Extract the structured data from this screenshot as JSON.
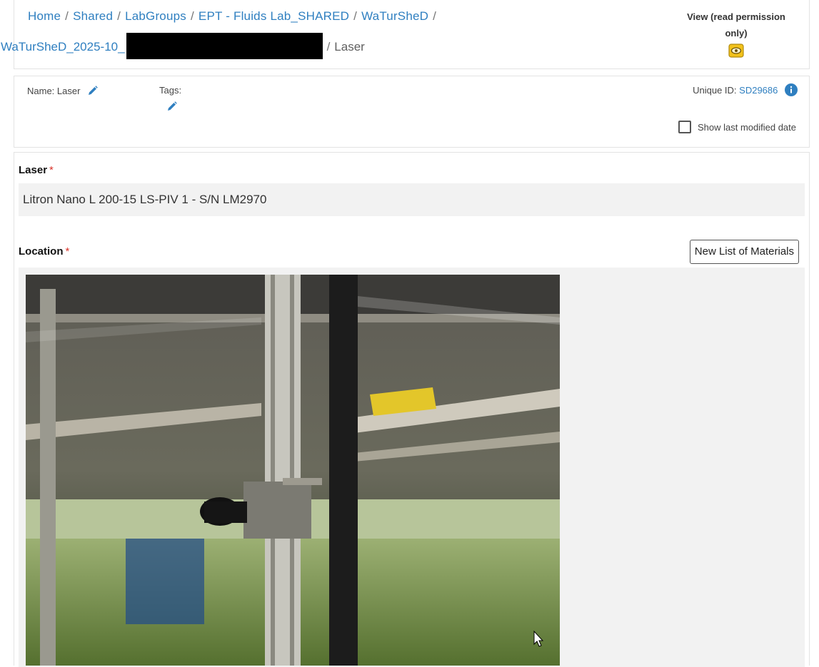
{
  "breadcrumb": {
    "items": [
      "Home",
      "Shared",
      "LabGroups",
      "EPT - Fluids Lab_SHARED",
      "WaTurSheD",
      "WaTurSheD_2025-10_"
    ],
    "current": "Laser",
    "separator": "/"
  },
  "permission": {
    "label": "View (read permission only)",
    "icon": "eye-icon"
  },
  "meta": {
    "name_label": "Name: Laser",
    "tags_label": "Tags:",
    "unique_id_label": "Unique ID:",
    "unique_id_value": "SD29686",
    "show_last_modified_label": "Show last modified date",
    "show_last_modified_checked": false
  },
  "fields": {
    "laser_label": "Laser",
    "laser_value": "Litron Nano L 200-15 LS-PIV 1 - S/N LM2970",
    "location_label": "Location",
    "required_mark": "*"
  },
  "buttons": {
    "new_list_of_materials": "New List of Materials"
  },
  "colors": {
    "link": "#2f7fc0",
    "required": "#d9342b",
    "info": "#2f7fc0",
    "permission_icon": "#f2c21b"
  }
}
